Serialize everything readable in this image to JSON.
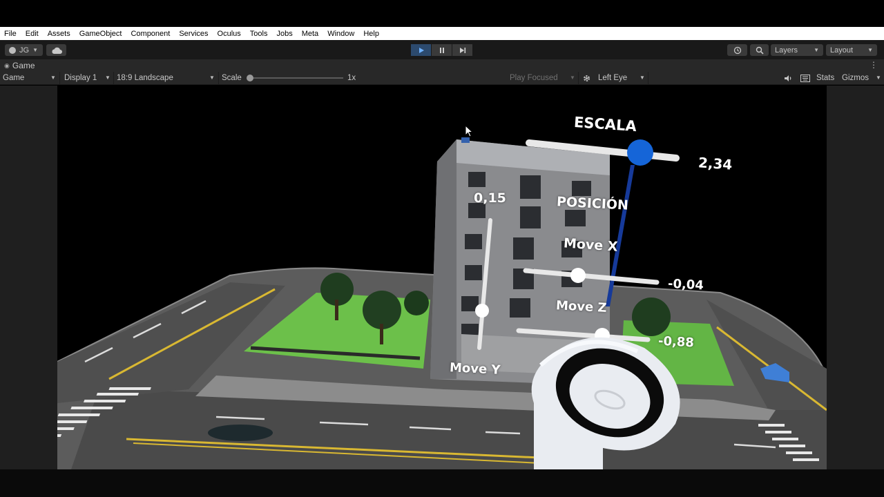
{
  "menubar": {
    "items": [
      "File",
      "Edit",
      "Assets",
      "GameObject",
      "Component",
      "Services",
      "Oculus",
      "Tools",
      "Jobs",
      "Meta",
      "Window",
      "Help"
    ]
  },
  "toolbar": {
    "account_label": "JG",
    "layers_label": "Layers",
    "layout_label": "Layout"
  },
  "tab": {
    "title": "Game"
  },
  "gamebar": {
    "mode": "Game",
    "display": "Display 1",
    "aspect": "18:9 Landscape",
    "scale_label": "Scale",
    "scale_value": "1x",
    "scale_fraction": 0.0,
    "play_mode": "Play Focused",
    "eye": "Left Eye",
    "stats": "Stats",
    "gizmos": "Gizmos"
  },
  "vr_ui": {
    "escala_title": "ESCALA",
    "escala_value": "2,34",
    "posicion_title": "POSICIÓN",
    "move_x_label": "Move X",
    "move_x_value": "-0,04",
    "move_z_label": "Move Z",
    "move_z_value": "-0,88",
    "move_y_label": "Move Y",
    "move_y_value": "0,15"
  },
  "colors": {
    "slider_knob_blue": "#1565d8",
    "accent_play": "#2c4a6e",
    "grass": "#6cc04a"
  }
}
